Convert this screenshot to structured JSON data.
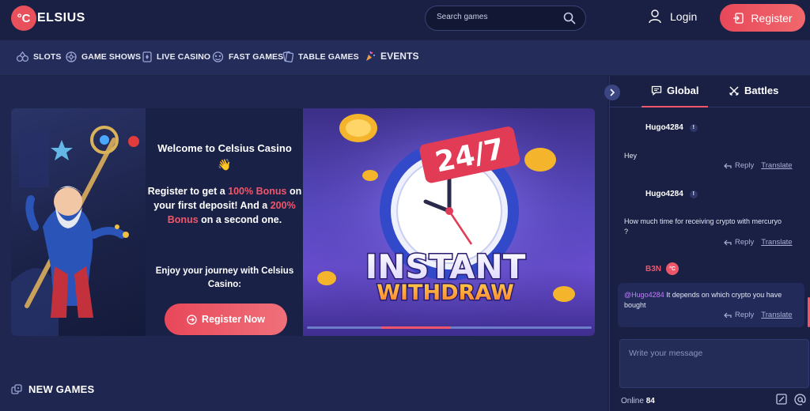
{
  "header": {
    "logo_mark": "°C",
    "logo_text": "ELSIUS",
    "search_placeholder": "Search games",
    "login_label": "Login",
    "register_label": "Register"
  },
  "nav": {
    "items": [
      {
        "label": "SLOTS",
        "icon": "slots-icon"
      },
      {
        "label": "GAME SHOWS",
        "icon": "game-shows-icon"
      },
      {
        "label": "LIVE CASINO",
        "icon": "live-casino-icon"
      },
      {
        "label": "FAST GAMES",
        "icon": "fast-games-icon"
      },
      {
        "label": "TABLE GAMES",
        "icon": "table-games-icon"
      },
      {
        "label": "EVENTS",
        "icon": "events-icon"
      }
    ]
  },
  "hero": {
    "welcome": "Welcome to Celsius Casino",
    "wave": "👋",
    "promo": {
      "p1": "Register to get a ",
      "bonus1": "100% Bonus",
      "p2": " on your first deposit! And a ",
      "bonus2": "200% Bonus",
      "p3": " on a second one."
    },
    "journey": "Enjoy your journey with Celsius Casino:",
    "cta_label": "Register Now",
    "banner": {
      "badge": "24/7",
      "line1": "INSTANT",
      "line2": "WITHDRAW"
    },
    "carousel": {
      "slides": 4,
      "active": 1
    }
  },
  "sections": {
    "new_games": "NEW GAMES"
  },
  "chat": {
    "tabs": {
      "global": "Global",
      "battles": "Battles"
    },
    "messages": [
      {
        "user": "Hugo4284",
        "text": "Hey",
        "reply": "Reply",
        "translate": "Translate"
      },
      {
        "user": "Hugo4284",
        "text": "How much time for receiving crypto with mercuryo ?",
        "reply": "Reply",
        "translate": "Translate"
      },
      {
        "user": "B3N",
        "mention": "@Hugo4284",
        "text": " It depends on which crypto you have bought",
        "reply": "Reply",
        "translate": "Translate"
      }
    ],
    "compose_placeholder": "Write your message",
    "online_label": "Online",
    "online_count": "84"
  },
  "colors": {
    "accent": "#f0566a",
    "background": "#1c2347",
    "panel": "#1a2044"
  }
}
